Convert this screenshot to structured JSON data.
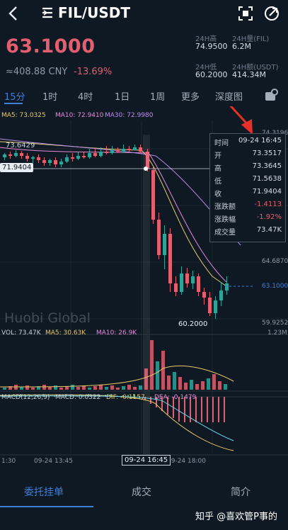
{
  "header": {
    "pair": "FIL/USDT"
  },
  "price": {
    "last": "63.1000",
    "cny": "≈408.88 CNY",
    "change": "-13.69%"
  },
  "stats": [
    {
      "label": "24H高",
      "value": "74.9500"
    },
    {
      "label": "24H量(FIL)",
      "value": "6.2M"
    },
    {
      "label": "24H低",
      "value": "60.2000"
    },
    {
      "label": "24H额(USDT)",
      "value": "414.34M"
    }
  ],
  "tabs": [
    "15分",
    "1时",
    "4时",
    "1日",
    "1周",
    "更多",
    "深度图"
  ],
  "ma_line": {
    "ma5": "MA5: 73.0325",
    "ma10": "MA10: 72.9410",
    "ma30": "MA30: 72.9980"
  },
  "vol_line": {
    "vol": "VOL: 73.47K",
    "ma5": "MA5: 30.63K",
    "ma10": "MA10: 26.9K"
  },
  "macd_line": {
    "macd_title": "MACD(12,26,9)",
    "macd": "MACD: 0.0322",
    "dif": "DIF: -0.1157",
    "dea": "DEA: -0.1479"
  },
  "crosshair": {
    "price": "71.9404",
    "time": "09-24 16:45"
  },
  "chart_labels": {
    "high_mark": "73.6429",
    "low_mark": "60.2000"
  },
  "right_axis": {
    "top": "74.3196",
    "mid": "64.6870",
    "last": "63.1000",
    "low": "59.9252",
    "vol_max": "1.23M"
  },
  "time_axis": [
    "1:30",
    "09-24 13:45",
    "09-24 18:00"
  ],
  "tooltip": [
    {
      "k": "时间",
      "v": "09-24 16:45"
    },
    {
      "k": "开",
      "v": "73.3517"
    },
    {
      "k": "高",
      "v": "73.3645"
    },
    {
      "k": "低",
      "v": "71.5638"
    },
    {
      "k": "收",
      "v": "71.9404"
    },
    {
      "k": "涨跌额",
      "v": "-1.4113"
    },
    {
      "k": "涨跌幅",
      "v": "-1.92%"
    },
    {
      "k": "成交量",
      "v": "73.47K"
    }
  ],
  "watermark": "Huobi Global",
  "bottom_tabs": [
    "委托挂单",
    "成交",
    "简介"
  ],
  "credit": "知乎 @喜欢管P事的",
  "colors": {
    "up": "#2ea39a",
    "down": "#e15f6e",
    "accent": "#3f7fd8",
    "bg": "#0f1923"
  },
  "icons": [
    "back-arrow-icon",
    "pair-menu-icon",
    "scan-icon",
    "share-icon",
    "chart-settings-icon"
  ]
}
